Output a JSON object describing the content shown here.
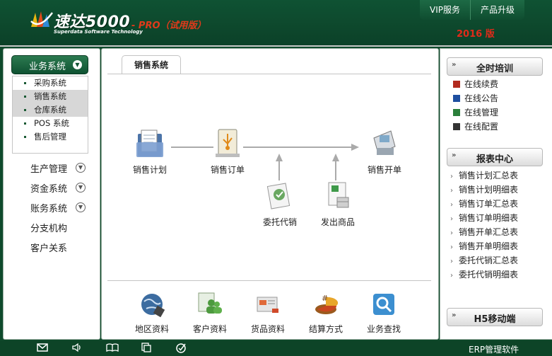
{
  "header": {
    "brand_name": "速达5000",
    "brand_sub": "Superdata Software Technology",
    "brand_edition": "- PRO（试用版）",
    "year_label": "2016 版",
    "topnav": [
      {
        "label": "VIP服务"
      },
      {
        "label": "产品升级"
      }
    ]
  },
  "sidebar": {
    "primary": "业务系统",
    "subitems": [
      {
        "label": "采购系统"
      },
      {
        "label": "销售系统"
      },
      {
        "label": "仓库系统"
      },
      {
        "label": "POS 系统"
      },
      {
        "label": "售后管理"
      }
    ],
    "menu": [
      {
        "label": "生产管理"
      },
      {
        "label": "资金系统"
      },
      {
        "label": "账务系统"
      },
      {
        "label": "分支机构"
      },
      {
        "label": "客户关系"
      }
    ]
  },
  "content": {
    "tab": "销售系统",
    "flow": [
      {
        "label": "销售计划"
      },
      {
        "label": "销售订单"
      },
      {
        "label": "销售开单"
      },
      {
        "label": "委托代销"
      },
      {
        "label": "发出商品"
      }
    ],
    "shortcuts": [
      {
        "label": "地区资料"
      },
      {
        "label": "客户资料"
      },
      {
        "label": "货品资料"
      },
      {
        "label": "结算方式"
      },
      {
        "label": "业务查找"
      }
    ]
  },
  "right": {
    "training_title": "全时培训",
    "training_items": [
      {
        "label": "在线续费",
        "color": "#b22a1e"
      },
      {
        "label": "在线公告",
        "color": "#1e4fa0"
      },
      {
        "label": "在线管理",
        "color": "#2a7f3a"
      },
      {
        "label": "在线配置",
        "color": "#333333"
      }
    ],
    "report_title": "报表中心",
    "report_items": [
      {
        "label": "销售计划汇总表"
      },
      {
        "label": "销售计划明细表"
      },
      {
        "label": "销售订单汇总表"
      },
      {
        "label": "销售订单明细表"
      },
      {
        "label": "销售开单汇总表"
      },
      {
        "label": "销售开单明细表"
      },
      {
        "label": "委托代销汇总表"
      },
      {
        "label": "委托代销明细表"
      }
    ],
    "mobile_title": "H5移动端"
  },
  "status": {
    "erp_label": "ERP管理软件"
  }
}
